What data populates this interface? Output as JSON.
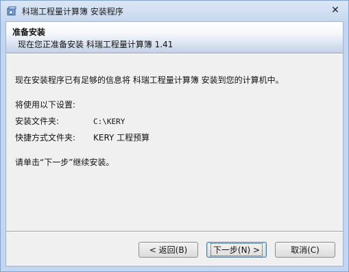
{
  "window": {
    "title": "科瑞工程量计算簿 安装程序",
    "close_glyph": "✕"
  },
  "header": {
    "title": "准备安装",
    "subtitle": "现在您正准备安装 科瑞工程量计算簿 1.41"
  },
  "body": {
    "intro": "现在安装程序已有足够的信息将 科瑞工程量计算簿 安装到您的计算机中。",
    "settings_heading": "将使用以下设置:",
    "install_folder_label": "安装文件夹:",
    "install_folder_value": "C:\\KERY",
    "shortcut_folder_label": "快捷方式文件夹:",
    "shortcut_folder_value": "KERY 工程预算",
    "instruction": "请单击“下一步”继续安装。"
  },
  "buttons": {
    "back": "< 返回(B)",
    "next": "下一步(N) >",
    "cancel": "取消(C)"
  },
  "icons": {
    "app": "installer-app-icon",
    "close": "close-icon"
  }
}
